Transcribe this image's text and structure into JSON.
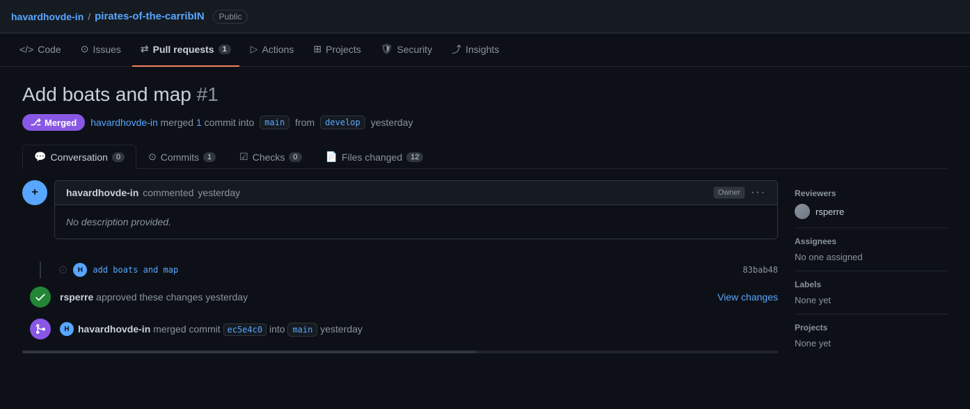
{
  "repo": {
    "owner": "havardhovde-in",
    "slash": "/",
    "name": "pirates-of-the-carribIN",
    "visibility": "Public"
  },
  "secondary_nav": {
    "items": [
      {
        "id": "code",
        "label": "Code",
        "icon": "⟨⟩",
        "badge": null,
        "active": false
      },
      {
        "id": "issues",
        "label": "Issues",
        "icon": "○",
        "badge": null,
        "active": false
      },
      {
        "id": "pull-requests",
        "label": "Pull requests",
        "icon": "⇄",
        "badge": "1",
        "active": true
      },
      {
        "id": "actions",
        "label": "Actions",
        "icon": "▷",
        "badge": null,
        "active": false
      },
      {
        "id": "projects",
        "label": "Projects",
        "icon": "⊞",
        "badge": null,
        "active": false
      },
      {
        "id": "security",
        "label": "Security",
        "icon": "🛡",
        "badge": null,
        "active": false
      },
      {
        "id": "insights",
        "label": "Insights",
        "icon": "📈",
        "badge": null,
        "active": false
      }
    ]
  },
  "pr": {
    "title": "Add boats and map",
    "number": "#1",
    "status": "Merged",
    "meta_text": "merged",
    "commit_count": "1",
    "commit_word": "commit",
    "base_branch": "main",
    "from_word": "from",
    "head_branch": "develop",
    "time": "yesterday"
  },
  "pr_tabs": [
    {
      "id": "conversation",
      "label": "Conversation",
      "badge": "0",
      "active": true,
      "icon": "💬"
    },
    {
      "id": "commits",
      "label": "Commits",
      "badge": "1",
      "active": false,
      "icon": "⊙"
    },
    {
      "id": "checks",
      "label": "Checks",
      "badge": "0",
      "active": false,
      "icon": "☑"
    },
    {
      "id": "files-changed",
      "label": "Files changed",
      "badge": "12",
      "active": false,
      "icon": "📄"
    }
  ],
  "comment": {
    "author": "havardhovde-in",
    "action": "commented",
    "time": "yesterday",
    "owner_label": "Owner",
    "body": "No description provided.",
    "more_icon": "···"
  },
  "commit_entry": {
    "message": "add boats and map",
    "sha": "83bab48"
  },
  "approved_entry": {
    "user": "rsperre",
    "action": "approved these changes",
    "time": "yesterday",
    "view_changes_label": "View changes"
  },
  "merged_entry": {
    "user": "havardhovde-in",
    "action": "merged commit",
    "commit_sha": "ec5e4c0",
    "into_word": "into",
    "branch": "main",
    "time": "yesterday"
  },
  "sidebar": {
    "reviewers_label": "Reviewers",
    "reviewers": [
      {
        "name": "rsperre"
      }
    ],
    "assignees_label": "Assignees",
    "assignees_value": "No one assigned",
    "labels_label": "Labels",
    "labels_value": "None yet",
    "projects_label": "Projects",
    "projects_value": "None yet"
  }
}
